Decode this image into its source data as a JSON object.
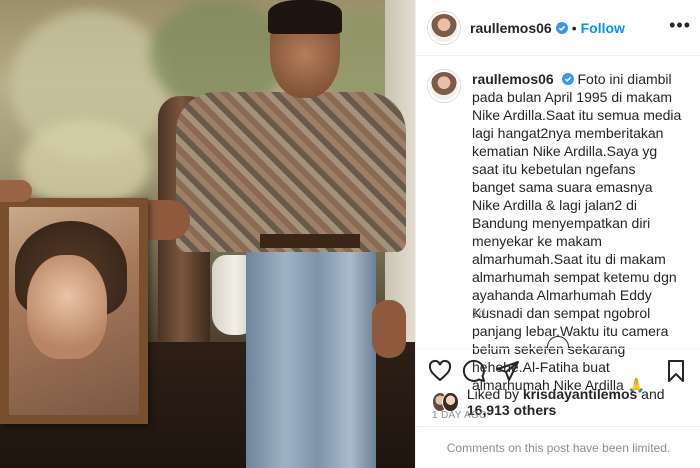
{
  "header": {
    "username": "raullemos06",
    "separator": "•",
    "follow_label": "Follow",
    "more_label": "•••"
  },
  "caption": {
    "username": "raullemos06",
    "text": "Foto ini diambil pada bulan April 1995 di makam Nike Ardilla.Saat itu semua media lagi hangat2nya memberitakan kematian Nike Ardilla.Saya yg saat itu kebetulan ngefans banget sama suara emasnya Nike Ardilla & lagi jalan2 di Bandung menyempatkan diri menyekar ke makam almarhumah.Saat itu di makam almarhumah sempat ketemu dgn ayahanda Almarhumah Eddy Kusnadi dan sempat ngobrol panjang lebar.Waktu itu camera belum sekeren sekarang hehehe.Al-Fatiha buat almarhumah Nike Ardilla 🙏",
    "time": "1d"
  },
  "likes": {
    "prefix": "Liked by",
    "user": "krisdayantilemos",
    "connector": "and",
    "count": "16,913 others"
  },
  "post_time": "1 DAY AGO",
  "comments_notice": "Comments on this post have been limited.",
  "icons": [
    "verified-icon",
    "heart-icon",
    "comment-icon",
    "share-icon",
    "bookmark-icon",
    "more-icon"
  ],
  "colors": {
    "accent": "#0095f6",
    "muted": "#8e8e8e",
    "text": "#262626"
  }
}
